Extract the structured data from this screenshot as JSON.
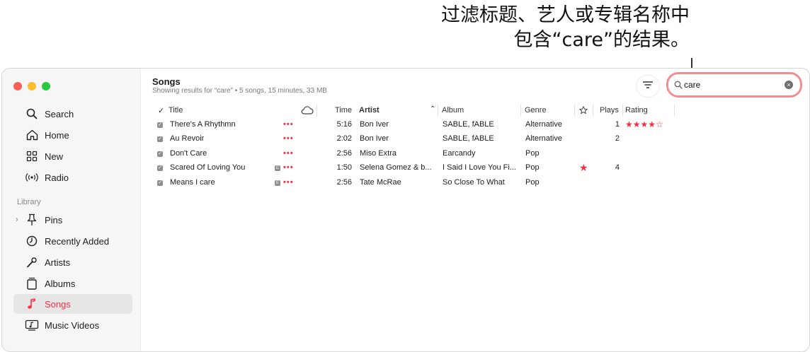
{
  "annotation": {
    "line1": "过滤标题、艺人或专辑名称中",
    "line2": "包含“care”的结果。"
  },
  "colors": {
    "accent": "#fa2d48",
    "callout_ring": "#ef8f92"
  },
  "sidebar": {
    "top_items": [
      {
        "label": "Search",
        "icon": "search-icon"
      },
      {
        "label": "Home",
        "icon": "home-icon"
      },
      {
        "label": "New",
        "icon": "grid-icon"
      },
      {
        "label": "Radio",
        "icon": "radio-icon"
      }
    ],
    "library_label": "Library",
    "library_items": [
      {
        "label": "Pins",
        "icon": "pin-icon"
      },
      {
        "label": "Recently Added",
        "icon": "clock-icon"
      },
      {
        "label": "Artists",
        "icon": "microphone-icon"
      },
      {
        "label": "Albums",
        "icon": "albums-icon"
      },
      {
        "label": "Songs",
        "icon": "music-note-icon",
        "selected": true
      },
      {
        "label": "Music Videos",
        "icon": "music-video-icon"
      }
    ]
  },
  "main": {
    "title": "Songs",
    "subtitle": "Showing results for “care” • 5 songs, 15 minutes, 33 MB",
    "search": {
      "value": "care",
      "placeholder": "Search"
    },
    "columns": {
      "check": "✓",
      "title": "Title",
      "time": "Time",
      "artist": "Artist",
      "album": "Album",
      "genre": "Genre",
      "plays": "Plays",
      "rating": "Rating"
    },
    "songs": [
      {
        "title": "There's A Rhythmn",
        "badge": "",
        "time": "5:16",
        "artist": "Bon Iver",
        "album": "SABLE, fABLE",
        "genre": "Alternative",
        "loved": false,
        "plays": "1",
        "rating": 4
      },
      {
        "title": "Au Revoir",
        "badge": "",
        "time": "2:02",
        "artist": "Bon Iver",
        "album": "SABLE, fABLE",
        "genre": "Alternative",
        "loved": false,
        "plays": "2",
        "rating": 0
      },
      {
        "title": "Don't Care",
        "badge": "",
        "time": "2:56",
        "artist": "Miso Extra",
        "album": "Earcandy",
        "genre": "Pop",
        "loved": false,
        "plays": "",
        "rating": 0
      },
      {
        "title": "Scared Of Loving You",
        "badge": "C",
        "time": "1:50",
        "artist": "Selena Gomez & b...",
        "album": "I Said I Love You Fi...",
        "genre": "Pop",
        "loved": true,
        "plays": "4",
        "rating": 0
      },
      {
        "title": "Means I care",
        "badge": "E",
        "time": "2:56",
        "artist": "Tate McRae",
        "album": "So Close To What",
        "genre": "Pop",
        "loved": false,
        "plays": "",
        "rating": 0
      }
    ]
  }
}
